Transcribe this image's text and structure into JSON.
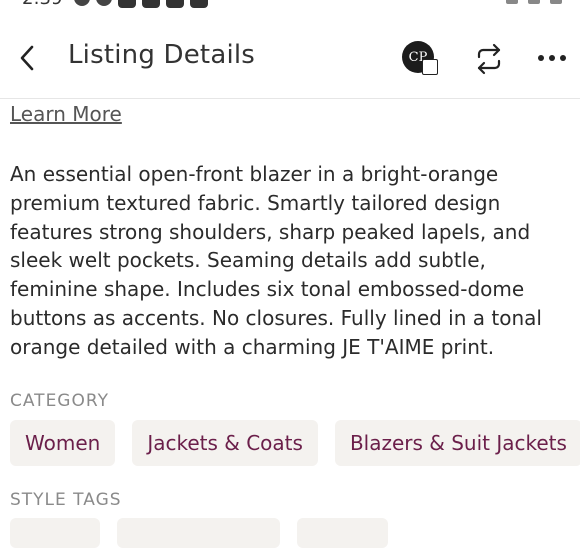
{
  "status_bar": {
    "time": "2:39"
  },
  "header": {
    "title": "Listing Details",
    "avatar_initials": "CP"
  },
  "content": {
    "learn_more": "Learn More",
    "description": "An essential open-front blazer in a bright-orange premium textured fabric. Smartly tailored design features strong shoulders, sharp peaked lapels, and sleek welt pockets. Seaming details add subtle, feminine shape. Includes six tonal embossed-dome buttons as accents. No closures. Fully lined in a tonal orange detailed with a charming JE T'AIME print.",
    "category_label": "CATEGORY",
    "categories": [
      "Women",
      "Jackets & Coats",
      "Blazers & Suit Jackets"
    ],
    "style_tags_label": "STYLE TAGS"
  },
  "colors": {
    "chip_bg": "#f4f2ef",
    "chip_text": "#6b1f4a",
    "section_label": "#8a8a8a"
  }
}
